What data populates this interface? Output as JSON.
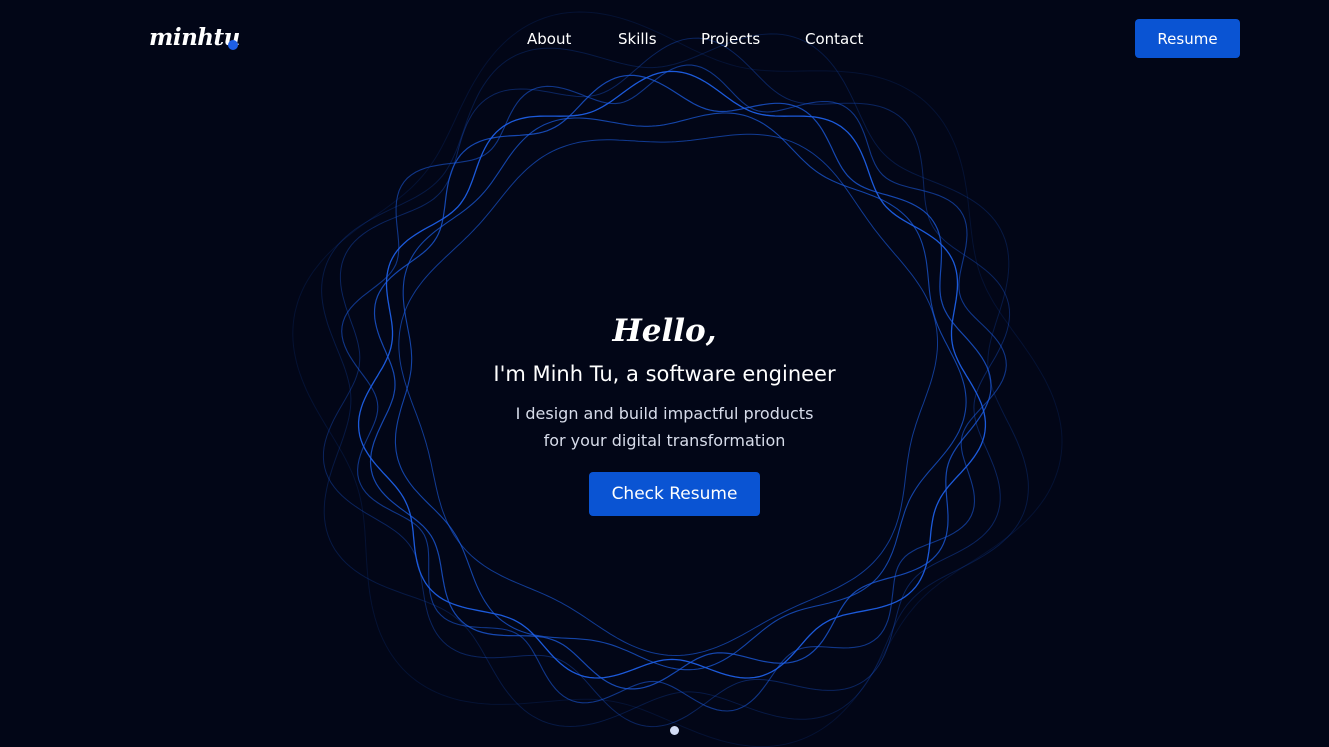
{
  "header": {
    "logo_text": "minhtu",
    "nav": [
      {
        "label": "About"
      },
      {
        "label": "Skills"
      },
      {
        "label": "Projects"
      },
      {
        "label": "Contact"
      }
    ],
    "resume_label": "Resume"
  },
  "hero": {
    "greeting": "Hello,",
    "title": "I'm Minh Tu, a software engineer",
    "subtitle_line1": "I design and build impactful products",
    "subtitle_line2": "for your digital transformation",
    "cta_label": "Check Resume"
  },
  "colors": {
    "background": "#020617",
    "accent": "#0a54d3",
    "ring_stroke": "#1d5fe6"
  }
}
